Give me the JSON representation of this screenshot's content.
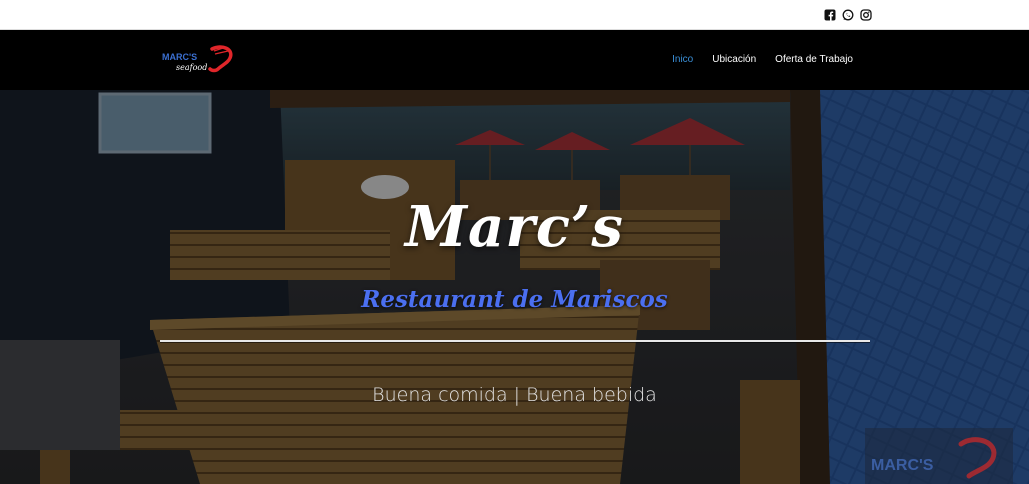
{
  "social": {
    "icons": [
      "facebook-icon",
      "whatsapp-icon",
      "instagram-icon"
    ]
  },
  "brand": {
    "logo_text_top": "MARC'S",
    "logo_text_bottom": "seafood",
    "colors": {
      "accent": "#3a8fd6",
      "logo_red": "#e0262a",
      "subtitle": "#4b6ff0"
    }
  },
  "nav": {
    "items": [
      {
        "label": "Inico",
        "active": true
      },
      {
        "label": "Ubicación",
        "active": false
      },
      {
        "label": "Oferta de Trabajo",
        "active": false
      }
    ]
  },
  "hero": {
    "title": "Marc’s",
    "subtitle": "Restaurant de Mariscos",
    "tagline": "Buena comida | Buena bebida",
    "watermark_text": "MARC'S"
  }
}
